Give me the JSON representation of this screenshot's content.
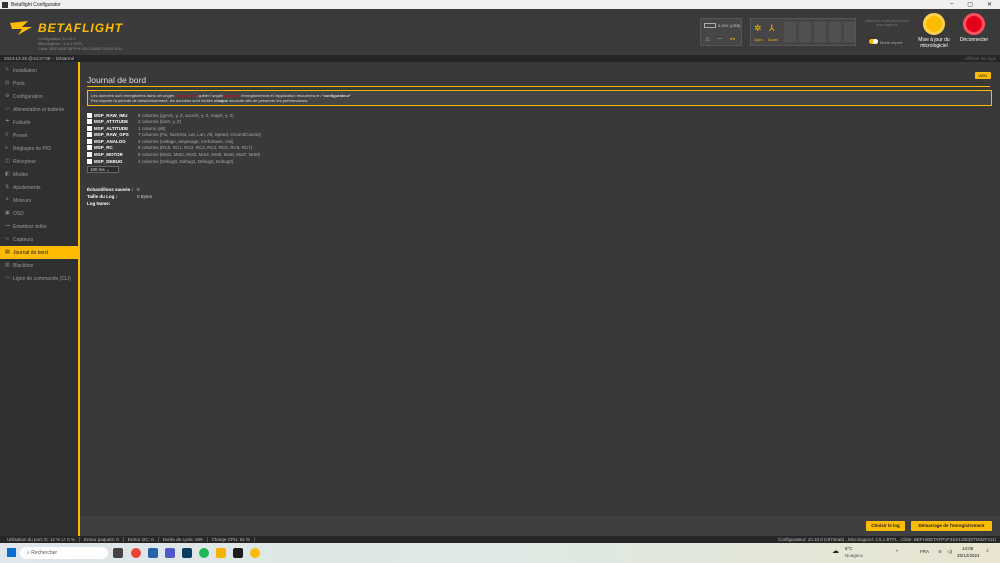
{
  "window": {
    "title": "Betaflight Configurator",
    "controls": [
      "–",
      "▢",
      "✕"
    ]
  },
  "header": {
    "brand": "BETAFLIGHT",
    "sub_lines": [
      "Configurator: 10.10.0",
      "Micrologiciel : 4.5.1 BTFL",
      "Cible: BEFH/BETAFPVF4SX1280(STM32F411)"
    ],
    "battery": "0.02V (USB)",
    "sensor_gyro": "Gyro",
    "sensor_accel": "Accel",
    "expert_hint": "Activez le mode expert pour plus d'options",
    "expert_label": "Mode expert",
    "fw_update": "Mise à jour du micrologiciel",
    "disconnect": "Déconnecter"
  },
  "status": {
    "datetime": "2024-12-25 @14:27:08 -- Désarmé",
    "show_logs": "Afficher les logs"
  },
  "sidebar": {
    "items": [
      {
        "label": "Installation",
        "icon": "wrench-icon"
      },
      {
        "label": "Ports",
        "icon": "plug-icon"
      },
      {
        "label": "Configuration",
        "icon": "gear-icon"
      },
      {
        "label": "Alimentation et batterie",
        "icon": "battery-icon"
      },
      {
        "label": "Failsafe",
        "icon": "parachute-icon"
      },
      {
        "label": "Preset",
        "icon": "preset-icon"
      },
      {
        "label": "Réglages de PID",
        "icon": "sliders-icon"
      },
      {
        "label": "Récepteur",
        "icon": "receiver-icon"
      },
      {
        "label": "Modes",
        "icon": "switch-icon"
      },
      {
        "label": "Ajustements",
        "icon": "adjust-icon"
      },
      {
        "label": "Moteurs",
        "icon": "motor-icon"
      },
      {
        "label": "OSD",
        "icon": "osd-icon"
      },
      {
        "label": "Émetteur vidéo",
        "icon": "video-icon"
      },
      {
        "label": "Capteurs",
        "icon": "sensor-icon"
      },
      {
        "label": "Journal de bord",
        "icon": "log-icon",
        "active": true
      },
      {
        "label": "Blackbox",
        "icon": "blackbox-icon"
      },
      {
        "label": "Ligne de commande (CLI)",
        "icon": "terminal-icon"
      }
    ]
  },
  "main": {
    "title": "Journal de bord",
    "wiki": "WIKI",
    "note": {
      "p1a": "Les données sont enregistrées dans cet onglet ",
      "p1b": "uniquement",
      "p1c": ", quitter l'onglet ",
      "p1d": "annulera",
      "p1e": " l'enregistrement et l'application retournera en ",
      "p1f": "\"configurateur\"",
      "p2a": "Peu importe la période de rafraîchissement, les données sont écrites ",
      "p2b": "chaque",
      "p2c": " seconde afin de préserver les performances."
    },
    "options": [
      {
        "name": "MSP_RAW_IMU",
        "desc": "9 columns (gyroX, y, Z, accelX, y, Z, magX, y, Z)"
      },
      {
        "name": "MSP_ATTITUDE",
        "desc": "3 columns (kinX, y, Z)"
      },
      {
        "name": "MSP_ALTITUDE",
        "desc": "1 column (alt)"
      },
      {
        "name": "MSP_RAW_GPS",
        "desc": "7 columns (Fix, NumSat, Lat, Lon, Alt, Speed, GroundCourse)"
      },
      {
        "name": "MSP_ANALOG",
        "desc": "4 columns (voltage, amperage, mAhdrawn, rssi)"
      },
      {
        "name": "MSP_RC",
        "desc": "8 columns (RC0, RC1, RC2, RC3, RC4, RC5, RC6, RC7)"
      },
      {
        "name": "MSP_MOTOR",
        "desc": "8 columns (Mot1, Mot2, Mot3, Mot4, Mot5, Mot6, Mot7, Mot8)"
      },
      {
        "name": "MSP_DEBUG",
        "desc": "4 columns (Debug0, Debug1, Debug2, Debug3)"
      }
    ],
    "interval": "100 ms",
    "samples_label": "Échantillons sauvés :",
    "samples_value": "0",
    "size_label": "Taille du Log :",
    "size_value": "0 Bytes",
    "name_label": "Log Name:",
    "btn_choose": "Choisir le log",
    "btn_start": "Démarrage de l'enregistrement"
  },
  "footer": {
    "port": "Utilisation du port: D: 12 % U: 0 %",
    "packets": "Erreur paquets: 0",
    "i2c": "Erreur I2C: 0",
    "cycle": "Durée de cycle: 309",
    "cpu": "Charge CPU: 54 %",
    "right": "Configurateur: 10.10.0 (c974ea6) , Micrologiciel: 4.5.1 BTFL , Cible: BEFH/BETAFPVF4SX1280(STM32F411)"
  },
  "taskbar": {
    "search": "Rechercher",
    "weather_temp": "8°C",
    "weather_desc": "Nuageux",
    "lang": "FRA",
    "time": "14:08",
    "date": "25/12/2024"
  },
  "colors": {
    "accent": "#ffbb00",
    "bg": "#393939",
    "sidebar": "#303030",
    "warn": "#e2001a"
  }
}
